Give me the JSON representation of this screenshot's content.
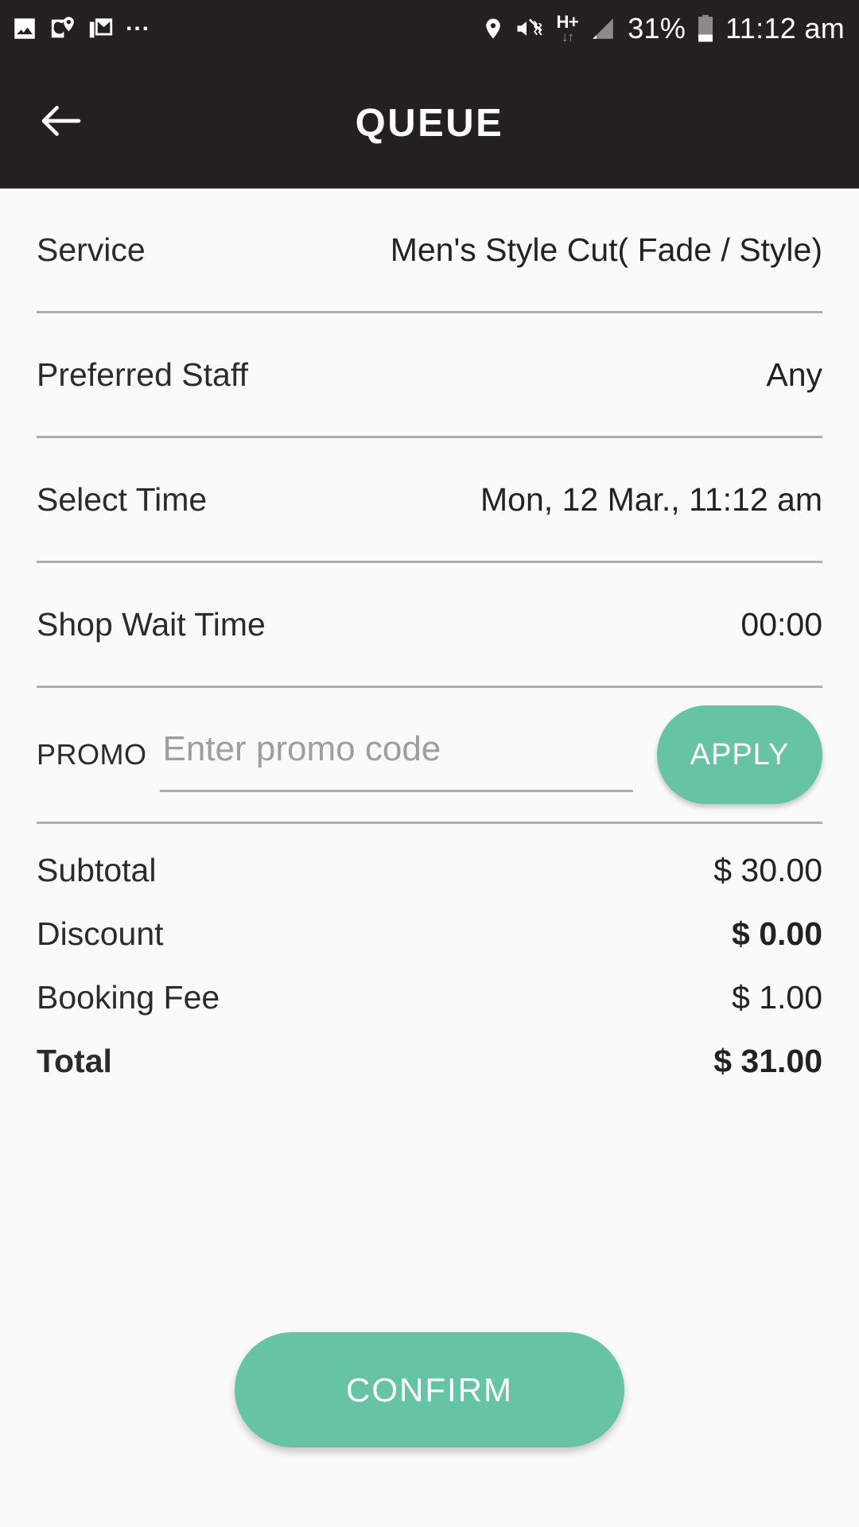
{
  "status_bar": {
    "left_icons": [
      "photos-icon",
      "google-maps-icon",
      "gmail-icon"
    ],
    "overflow": "...",
    "right_icons": [
      "location-pin-icon",
      "volume-mute-vibrate-icon",
      "hplus-network-icon",
      "signal-bars-icon",
      "battery-icon"
    ],
    "network_type": "H+",
    "battery_percent": "31%",
    "time": "11:12 am"
  },
  "app_bar": {
    "title": "QUEUE",
    "back_icon": "arrow-left-icon"
  },
  "details": [
    {
      "label": "Service",
      "value": "Men's Style Cut( Fade / Style)"
    },
    {
      "label": "Preferred Staff",
      "value": "Any"
    },
    {
      "label": "Select Time",
      "value": "Mon, 12 Mar., 11:12 am"
    },
    {
      "label": "Shop Wait Time",
      "value": "00:00"
    }
  ],
  "promo": {
    "label": "PROMO",
    "placeholder": "Enter promo code",
    "value": "",
    "apply_label": "APPLY"
  },
  "summary": [
    {
      "label": "Subtotal",
      "value": "$ 30.00",
      "label_bold": false,
      "value_bold": false
    },
    {
      "label": "Discount",
      "value": "$ 0.00",
      "label_bold": false,
      "value_bold": true
    },
    {
      "label": "Booking Fee",
      "value": "$ 1.00",
      "label_bold": false,
      "value_bold": false
    },
    {
      "label": "Total",
      "value": "$ 31.00",
      "label_bold": true,
      "value_bold": true
    }
  ],
  "confirm": {
    "label": "CONFIRM"
  },
  "colors": {
    "accent_green": "#66C3A3",
    "app_bar_dark": "#242021",
    "background": "#FAFAFA",
    "divider": "#AEAEAE"
  }
}
